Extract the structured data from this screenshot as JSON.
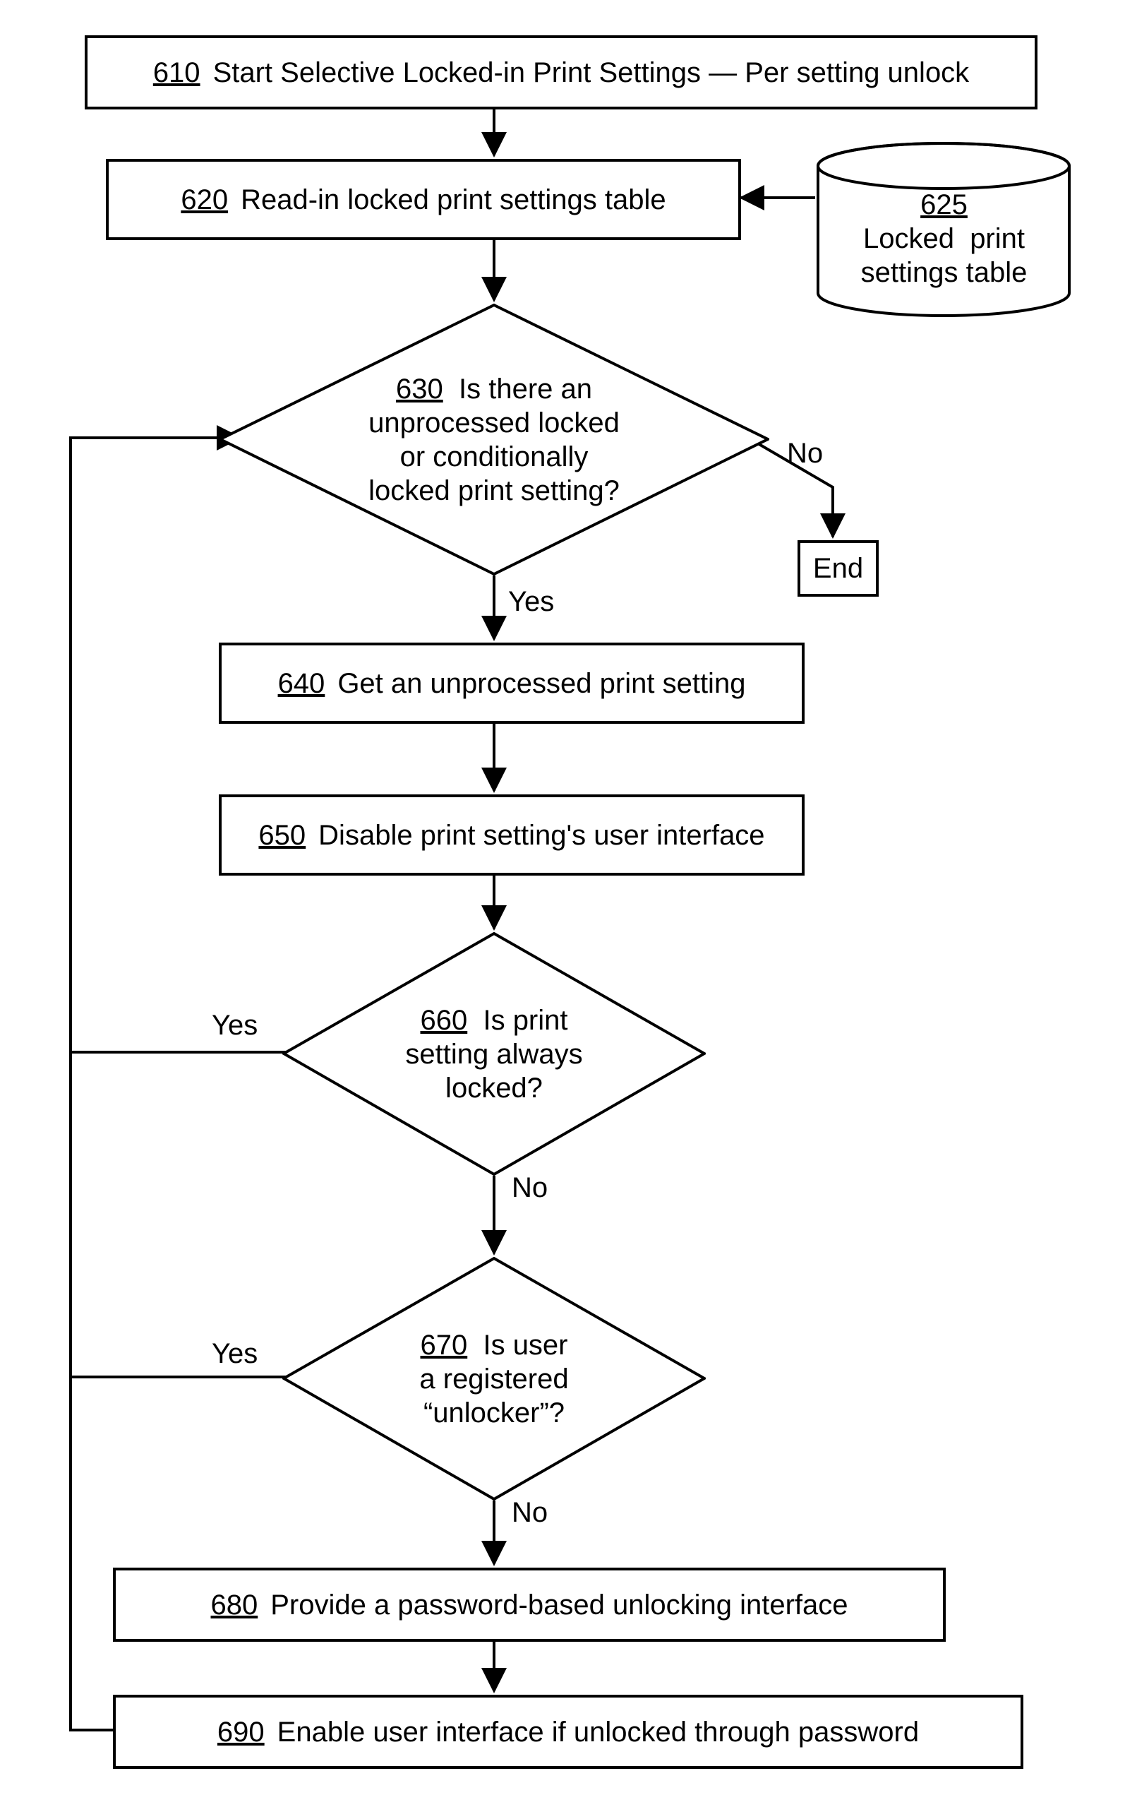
{
  "nodes": {
    "n610": {
      "num": "610",
      "text": "Start  Selective Locked-in Print Settings — Per setting unlock"
    },
    "n620": {
      "num": "620",
      "text": "Read-in locked print settings table"
    },
    "n625": {
      "num": "625",
      "text": "Locked  print\nsettings table"
    },
    "n630": {
      "num": "630",
      "text": "Is there an\nunprocessed locked\nor conditionally\nlocked print setting?"
    },
    "n640": {
      "num": "640",
      "text": "Get an unprocessed print setting"
    },
    "n650": {
      "num": "650",
      "text": "Disable print setting's user interface"
    },
    "n660": {
      "num": "660",
      "text": "Is print\nsetting always\nlocked?"
    },
    "n670": {
      "num": "670",
      "text": "Is user\na registered\n“unlocker”?"
    },
    "n680": {
      "num": "680",
      "text": "Provide a password-based unlocking interface"
    },
    "n690": {
      "num": "690",
      "text": "Enable user interface if unlocked through password"
    },
    "end": {
      "text": "End"
    }
  },
  "labels": {
    "yes": "Yes",
    "no": "No"
  }
}
